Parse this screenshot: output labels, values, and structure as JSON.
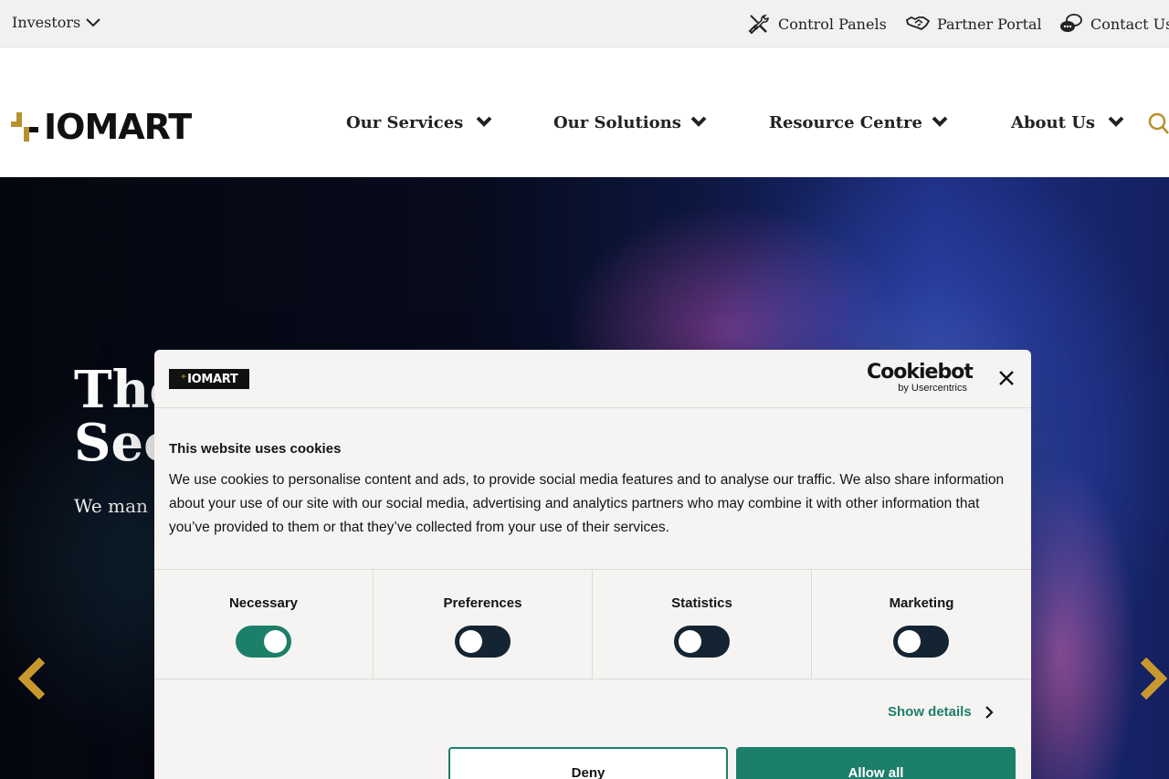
{
  "topbar": {
    "investors_label": "Investors",
    "links": [
      {
        "label": "Control Panels",
        "icon": "tools-icon"
      },
      {
        "label": "Partner Portal",
        "icon": "handshake-icon"
      },
      {
        "label": "Contact Us",
        "icon": "chat-icon"
      }
    ]
  },
  "header": {
    "logo_text": "IOMART",
    "nav": [
      {
        "label": "Our Services"
      },
      {
        "label": "Our Solutions"
      },
      {
        "label": "Resource Centre"
      },
      {
        "label": "About Us"
      }
    ]
  },
  "hero": {
    "title": "The\nSec",
    "subtitle": "We man technolo cloud so"
  },
  "cookie_dialog": {
    "logo_text": "IOMART",
    "brand": "Cookiebot",
    "brand_sub": "by Usercentrics",
    "title": "This website uses cookies",
    "body": "We use cookies to personalise content and ads, to provide social media features and to analyse our traffic. We also share information about your use of our site with our social media, advertising and analytics partners who may combine it with other information that you’ve provided to them or that they’ve collected from your use of their services.",
    "categories": [
      {
        "label": "Necessary",
        "enabled": true
      },
      {
        "label": "Preferences",
        "enabled": false
      },
      {
        "label": "Statistics",
        "enabled": false
      },
      {
        "label": "Marketing",
        "enabled": false
      }
    ],
    "show_details": "Show details",
    "deny": "Deny",
    "allow_all": "Allow all"
  },
  "colors": {
    "brand_gold": "#b8912f",
    "accent_green": "#1c7f6a",
    "toggle_off": "#142433"
  }
}
